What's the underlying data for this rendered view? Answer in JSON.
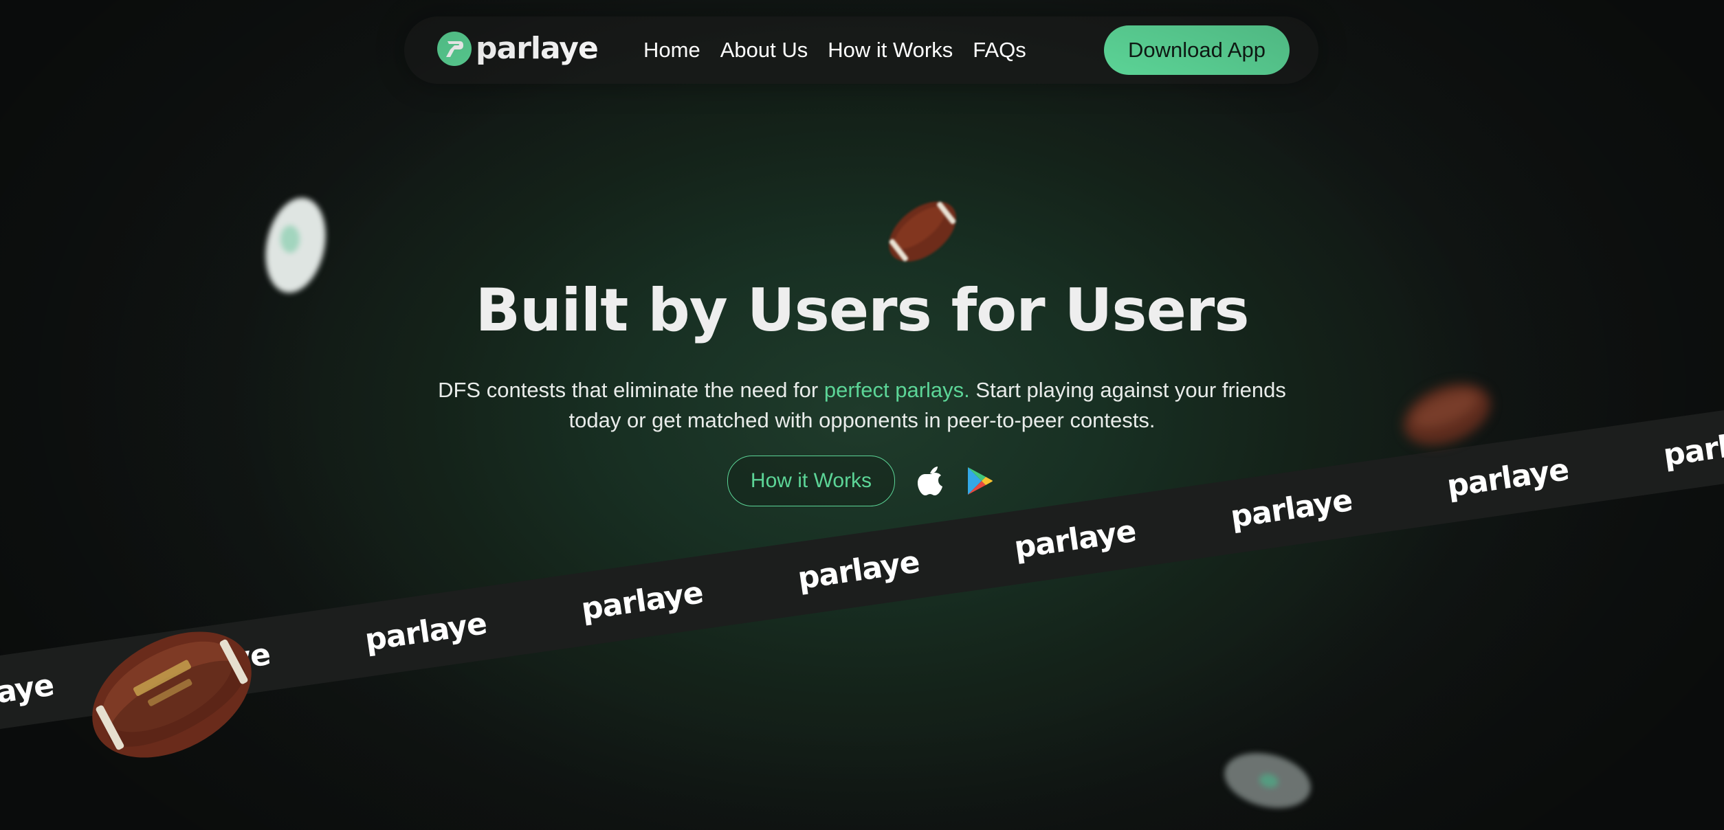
{
  "brand": {
    "name": "parlaye",
    "accent_color": "#5cd597",
    "background_color": "#101312"
  },
  "nav": {
    "links": [
      "Home",
      "About Us",
      "How it Works",
      "FAQs"
    ],
    "download_label": "Download App"
  },
  "hero": {
    "headline": "Built by Users for Users",
    "sub_before": "DFS contests that eliminate the need for ",
    "sub_accent": "perfect parlays.",
    "sub_after": " Start playing against your friends today or get matched with opponents in peer-to-peer contests.",
    "how_button_label": "How it Works",
    "store_icons": [
      "apple-icon",
      "google-play-icon"
    ]
  },
  "banner": {
    "words": [
      "parlaye",
      "parlaye",
      "parlaye",
      "parlaye",
      "parlaye",
      "parlaye",
      "parlaye",
      "parlaye",
      "parlaye"
    ]
  }
}
